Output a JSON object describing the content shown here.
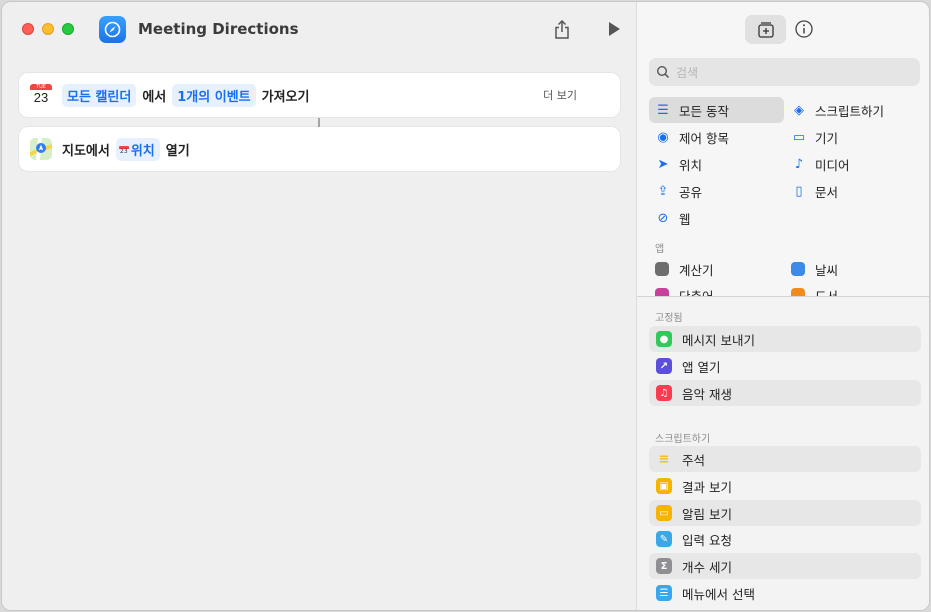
{
  "window": {
    "title": "Meeting Directions"
  },
  "actions": [
    {
      "parts": [
        {
          "kind": "token",
          "text": "모든 캘린더"
        },
        {
          "kind": "word",
          "text": "에서"
        },
        {
          "kind": "token",
          "text": "1개의 이벤트"
        },
        {
          "kind": "word",
          "text": "가져오기"
        }
      ],
      "more": "더 보기",
      "icon_day": "23",
      "icon_month": "TUE"
    },
    {
      "parts": [
        {
          "kind": "word",
          "text": "지도에서"
        },
        {
          "kind": "token",
          "text": "위치",
          "prefix_icon": "23"
        },
        {
          "kind": "word",
          "text": "열기"
        }
      ]
    }
  ],
  "sidebar": {
    "search_placeholder": "검색",
    "categories": [
      {
        "label": "모든 동작",
        "icon": "list-icon",
        "glyph": "☰",
        "selected": true
      },
      {
        "label": "스크립트하기",
        "icon": "script-icon",
        "glyph": "◈"
      },
      {
        "label": "제어 항목",
        "icon": "toggle-icon",
        "glyph": "◉"
      },
      {
        "label": "기기",
        "icon": "display-icon",
        "glyph": "▭"
      },
      {
        "label": "위치",
        "icon": "location-icon",
        "glyph": "➤"
      },
      {
        "label": "미디어",
        "icon": "music-note-icon",
        "glyph": "♪"
      },
      {
        "label": "공유",
        "icon": "share-icon",
        "glyph": "⇪"
      },
      {
        "label": "문서",
        "icon": "document-icon",
        "glyph": "▯"
      },
      {
        "label": "웹",
        "icon": "compass-icon",
        "glyph": "⊘"
      }
    ],
    "apps_header": "앱",
    "apps": [
      {
        "label": "계산기",
        "icon": "calculator-icon",
        "color": "#6e6e6e"
      },
      {
        "label": "날씨",
        "icon": "weather-icon",
        "color": "#3d8be8"
      },
      {
        "label": "단축어",
        "icon": "shortcuts-icon",
        "color": "#c8409a"
      },
      {
        "label": "도서",
        "icon": "books-icon",
        "color": "#f08a1c"
      }
    ],
    "pinned_header": "고정됨",
    "pinned": [
      {
        "label": "메시지 보내기",
        "icon": "messages-icon",
        "color": "#34c759",
        "glyph": "●"
      },
      {
        "label": "앱 열기",
        "icon": "open-app-icon",
        "color": "#5b4fdc",
        "glyph": "↗"
      },
      {
        "label": "음악 재생",
        "icon": "music-icon",
        "color": "#fa3b50",
        "glyph": "♫"
      }
    ],
    "scripting_header": "스크립트하기",
    "scripting": [
      {
        "label": "주석",
        "icon": "comment-icon",
        "color": "#f2d24b",
        "glyph": "≡"
      },
      {
        "label": "결과 보기",
        "icon": "show-result-icon",
        "color": "#f5b400",
        "glyph": "▣"
      },
      {
        "label": "알림 보기",
        "icon": "alert-icon",
        "color": "#f5b400",
        "glyph": "▭"
      },
      {
        "label": "입력 요청",
        "icon": "ask-input-icon",
        "color": "#3aa8e8",
        "glyph": "✎"
      },
      {
        "label": "개수 세기",
        "icon": "count-icon",
        "color": "#8e8e93",
        "glyph": "Σ"
      },
      {
        "label": "메뉴에서 선택",
        "icon": "menu-icon",
        "color": "#3aa8e8",
        "glyph": "☰"
      }
    ]
  }
}
